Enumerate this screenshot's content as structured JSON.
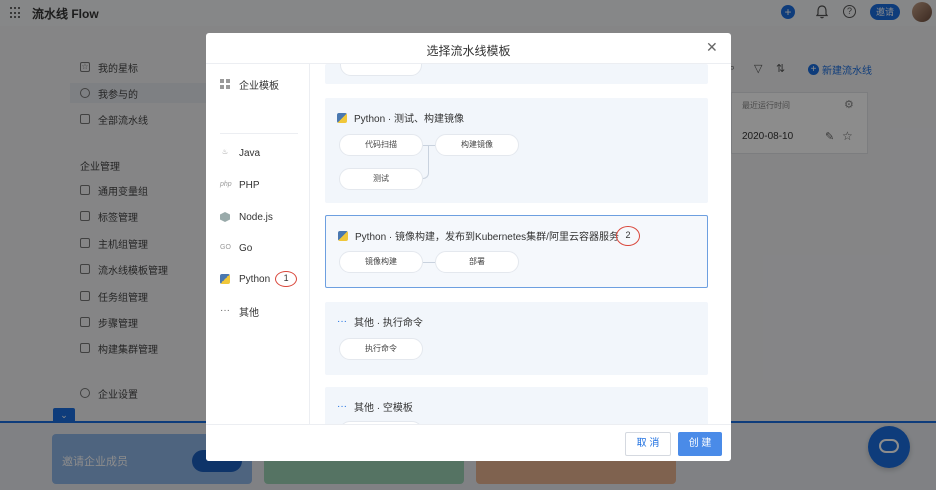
{
  "topbar": {
    "title": "流水线 Flow",
    "invite_label": "邀请"
  },
  "nav": {
    "items": [
      {
        "label": "我的星标",
        "icon": "star-icon"
      },
      {
        "label": "我参与的",
        "icon": "user-icon",
        "active": true
      },
      {
        "label": "全部流水线",
        "icon": "flow-icon"
      }
    ],
    "section_title": "企业管理",
    "admin_items": [
      {
        "label": "通用变量组",
        "icon": "variable-icon"
      },
      {
        "label": "标签管理",
        "icon": "tag-icon"
      },
      {
        "label": "主机组管理",
        "icon": "host-icon"
      },
      {
        "label": "流水线模板管理",
        "icon": "template-icon"
      },
      {
        "label": "任务组管理",
        "icon": "task-icon"
      },
      {
        "label": "步骤管理",
        "icon": "step-icon"
      },
      {
        "label": "构建集群管理",
        "icon": "cluster-icon"
      }
    ],
    "settings_label": "企业设置"
  },
  "background": {
    "new_pipeline_label": "新建流水线",
    "table_header": "最近运行时间",
    "table_cell": "2020-08-10"
  },
  "promos": {
    "invite_text": "邀请企业成员"
  },
  "modal": {
    "title": "选择流水线模板",
    "categories": [
      {
        "label": "企业模板",
        "icon": "grid-icon"
      },
      {
        "label": "Java",
        "icon": "java-icon"
      },
      {
        "label": "PHP",
        "icon": "php-icon"
      },
      {
        "label": "Node.js",
        "icon": "nodejs-icon"
      },
      {
        "label": "Go",
        "icon": "go-icon"
      },
      {
        "label": "Python",
        "icon": "python-icon"
      },
      {
        "label": "其他",
        "icon": "more-icon"
      }
    ],
    "category_badge": "1",
    "templates": [
      {
        "title": "Python · 测试、构建镜像",
        "steps": [
          "代码扫描",
          "构建镜像",
          "测试"
        ]
      },
      {
        "title": "Python · 镜像构建，发布到Kubernetes集群/阿里云容器服务",
        "steps": [
          "镜像构建",
          "部署"
        ],
        "badge": "2"
      },
      {
        "title": "其他 · 执行命令",
        "steps": [
          "执行命令"
        ]
      },
      {
        "title": "其他 · 空模板",
        "steps": []
      }
    ],
    "cancel_label": "取 消",
    "create_label": "创 建"
  },
  "colors": {
    "accent": "#1b6ee0",
    "annotation": "#d9463a"
  }
}
